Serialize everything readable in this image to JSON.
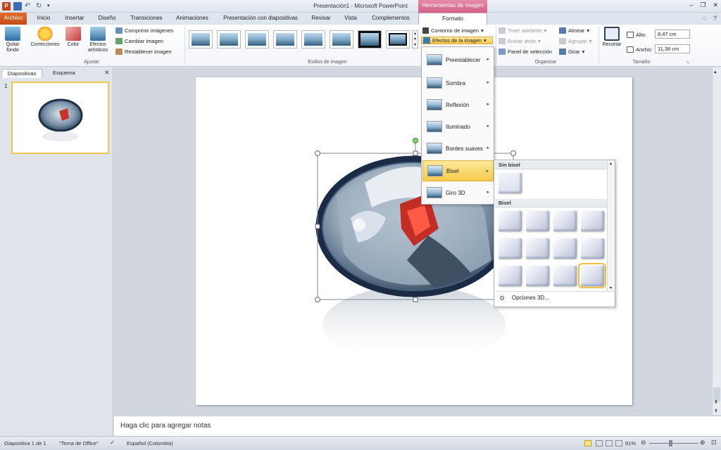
{
  "window": {
    "title": "Presentación1  -  Microsoft PowerPoint",
    "tools_header": "Herramientas de imagen",
    "buttons": [
      "–",
      "❐",
      "✕"
    ]
  },
  "qat": {
    "logo": "P"
  },
  "tabs": [
    {
      "label": "Archivo",
      "kind": "file"
    },
    {
      "label": "Inicio"
    },
    {
      "label": "Insertar"
    },
    {
      "label": "Diseño"
    },
    {
      "label": "Transiciones"
    },
    {
      "label": "Animaciones"
    },
    {
      "label": "Presentación con diapositivas"
    },
    {
      "label": "Revisar"
    },
    {
      "label": "Vista"
    },
    {
      "label": "Complementos"
    },
    {
      "label": "Formato",
      "kind": "active"
    }
  ],
  "ribbon": {
    "ajustar": {
      "label": "Ajustar",
      "quitar_fondo": "Quitar fondo",
      "correcciones": "Correcciones",
      "color": "Color",
      "efectos_artisticos": "Efectos artísticos",
      "comprimir": "Comprimir imágenes",
      "cambiar": "Cambiar imagen",
      "restablecer": "Restablecer imagen"
    },
    "estilos": {
      "label": "Estilos de imagen"
    },
    "picture_format": {
      "contorno": "Contorno de imagen",
      "efectos": "Efectos de la imagen"
    },
    "organizar": {
      "label": "Organizar",
      "traer": "Traer adelante",
      "enviar": "Enviar atrás",
      "panel": "Panel de selección",
      "alinear": "Alinear",
      "agrupar": "Agrupar",
      "girar": "Girar"
    },
    "tamano": {
      "label": "Tamaño",
      "recortar": "Recortar",
      "alto_label": "Alto:",
      "alto_value": "8,47 cm",
      "ancho_label": "Ancho:",
      "ancho_value": "11,38 cm"
    }
  },
  "left_panel": {
    "tabs": [
      "Diapositivas",
      "Esquema"
    ],
    "slide_number": "1"
  },
  "effects_menu": [
    {
      "label": "Preestablecer"
    },
    {
      "label": "Sombra"
    },
    {
      "label": "Reflexión"
    },
    {
      "label": "Iluminado"
    },
    {
      "label": "Bordes suaves"
    },
    {
      "label": "Bisel",
      "highlighted": true
    },
    {
      "label": "Giro 3D"
    }
  ],
  "bevel_panel": {
    "header_none": "Sin bisel",
    "header_bevel": "Bisel",
    "options": "Opciones 3D..."
  },
  "notes": {
    "placeholder": "Haga clic para agregar notas"
  },
  "status": {
    "slide": "Diapositiva 1 de 1",
    "theme": "\"Tema de Office\"",
    "language": "Español (Colombia)",
    "zoom": "91%"
  }
}
